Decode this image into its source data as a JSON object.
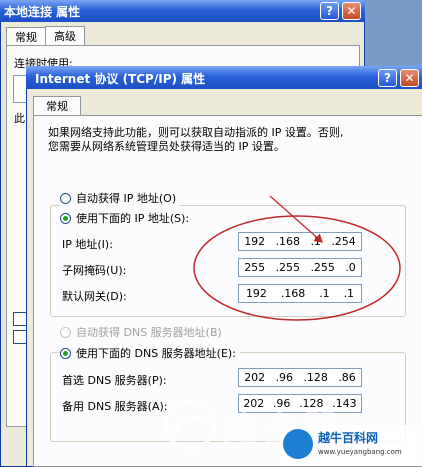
{
  "back_window": {
    "title": "本地连接 属性",
    "tabs": [
      "常规",
      "高级"
    ],
    "connect_using_label": "连接时使用:",
    "side_char": "此",
    "help_symbol": "?",
    "close_symbol": "✕"
  },
  "front_window": {
    "title": "Internet 协议 (TCP/IP) 属性",
    "tab": "常规",
    "description_line1": "如果网络支持此功能，则可以获取自动指派的 IP 设置。否则,",
    "description_line2": "您需要从网络系统管理员处获得适当的 IP 设置。",
    "help_symbol": "?",
    "close_symbol": "✕",
    "ip": {
      "auto_label": "自动获得 IP 地址(O)",
      "manual_label": "使用下面的 IP 地址(S):",
      "selected": "manual",
      "fields": [
        {
          "label": "IP 地址(I):",
          "octets": [
            "192",
            ".168",
            ".1",
            ".254"
          ]
        },
        {
          "label": "子网掩码(U):",
          "octets": [
            "255",
            ".255",
            ".255",
            ".0"
          ]
        },
        {
          "label": "默认网关(D):",
          "octets": [
            "192",
            ".168",
            ".1",
            ".1"
          ]
        }
      ]
    },
    "dns": {
      "auto_label": "自动获得 DNS 服务器地址(B)",
      "manual_label": "使用下面的 DNS 服务器地址(E):",
      "selected": "manual",
      "fields": [
        {
          "label": "首选 DNS 服务器(P):",
          "octets": [
            "202",
            ".96",
            ".128",
            ".86"
          ]
        },
        {
          "label": "备用 DNS 服务器(A):",
          "octets": [
            "202",
            ".96",
            ".128",
            ".143"
          ]
        }
      ]
    }
  },
  "watermark": {
    "brand": "路由器",
    "site_name": "越牛百科网",
    "url": "www.yueyangbang.com"
  },
  "annotation_color": "#c0282a"
}
